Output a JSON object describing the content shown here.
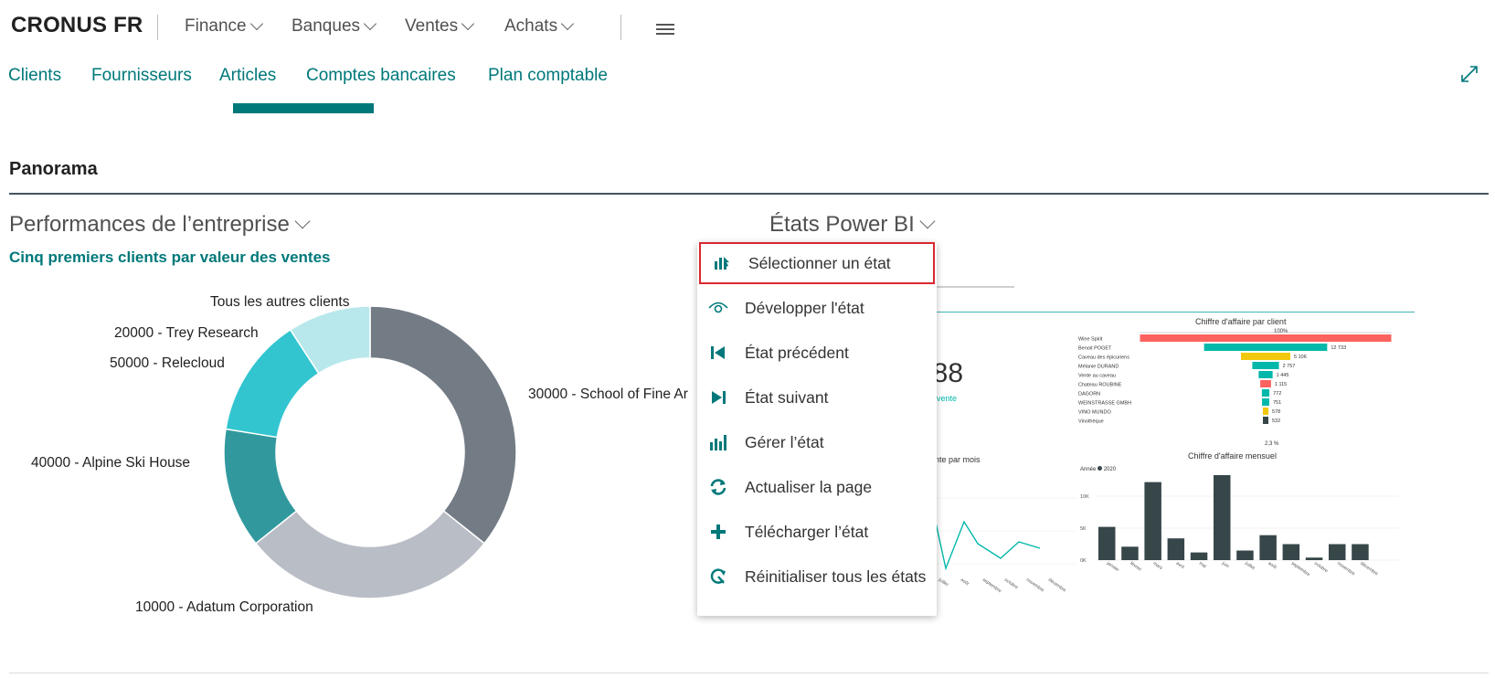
{
  "header": {
    "brand": "CRONUS FR",
    "menus": [
      "Finance",
      "Banques",
      "Ventes",
      "Achats"
    ]
  },
  "nav": {
    "items": [
      "Clients",
      "Fournisseurs",
      "Articles",
      "Comptes bancaires",
      "Plan comptable"
    ]
  },
  "section": {
    "title": "Panorama"
  },
  "performance": {
    "title": "Performances de l’entreprise",
    "subtitle": "Cinq premiers clients par valeur des ventes",
    "labels": {
      "others": "Tous les autres clients",
      "trey": "20000 - Trey Research",
      "relecloud": "50000 - Relecloud",
      "alpine": "40000 - Alpine Ski House",
      "adatum": "10000 - Adatum Corporation",
      "school": "30000 - School of Fine Ar"
    }
  },
  "powerbi": {
    "title": "États Power BI",
    "kpi_value": "588",
    "kpi_caption": "vente",
    "line_title": "nte par mois",
    "bar_client_title": "Chiffre d'affaire par client",
    "bar_client_top": "100%",
    "bar_client_bottom": "2,3 %",
    "monthly_title": "Chiffre d'affaire mensuel",
    "monthly_legend": "Année",
    "monthly_legend_year": "2020"
  },
  "menu": {
    "items": [
      {
        "label": "Sélectionner un état"
      },
      {
        "label": "Développer l'état"
      },
      {
        "label": "État précédent"
      },
      {
        "label": "État suivant"
      },
      {
        "label": "Gérer l’état"
      },
      {
        "label": "Actualiser la page"
      },
      {
        "label": "Télécharger l’état"
      },
      {
        "label": "Réinitialiser tous les états"
      }
    ]
  },
  "colors": {
    "accent": "#00787a",
    "highlight_border": "#d9282f",
    "bi_dark": "#374649",
    "bi_teal": "#01b8aa",
    "bi_red": "#fd625e",
    "bi_yellow": "#f2c80f"
  },
  "chart_data": [
    {
      "type": "pie",
      "title": "Cinq premiers clients par valeur des ventes",
      "categories": [
        "30000 - School of Fine Ar",
        "10000 - Adatum Corporation",
        "40000 - Alpine Ski House",
        "50000 - Relecloud",
        "20000 - Trey Research",
        "Tous les autres clients"
      ],
      "values": [
        35,
        28,
        0,
        0,
        11,
        8
      ],
      "donut": true
    },
    {
      "type": "bar",
      "title": "Chiffre d'affaire par client",
      "categories": [
        "Wine Spirit",
        "Benoit POGET",
        "Caveau des épicuriens",
        "Mélanie DURAND",
        "Vente au caveau",
        "Chateau ROUBINE",
        "DAGORN",
        "WEINSTRASSE GMBH",
        "VINO MUNDO",
        "Vinothèque"
      ],
      "values": [
        26000,
        12733,
        5106,
        2757,
        1445,
        1115,
        772,
        751,
        578,
        532
      ],
      "data_labels": [
        "",
        "12 733",
        "5 106",
        "2 757",
        "1 445",
        "1 115",
        "772",
        "751",
        "578",
        "532"
      ]
    },
    {
      "type": "bar",
      "title": "Chiffre d'affaire mensuel",
      "categories": [
        "janvier",
        "février",
        "mars",
        "avril",
        "mai",
        "juin",
        "juillet",
        "août",
        "septembre",
        "octobre",
        "novembre",
        "décembre"
      ],
      "series": [
        {
          "name": "2020",
          "values": [
            5.2,
            2.1,
            12.2,
            3.4,
            1.2,
            14.0,
            1.5,
            3.9,
            2.5,
            0.4,
            2.5,
            2.5
          ]
        }
      ],
      "y_ticks": [
        "0K",
        "5K",
        "10K"
      ]
    },
    {
      "type": "line",
      "title": "nte par mois",
      "categories": [
        "juillet",
        "août",
        "septembre",
        "octobre",
        "novembre",
        "décembre"
      ],
      "values": [
        2,
        5,
        3,
        1,
        3,
        2
      ]
    }
  ]
}
